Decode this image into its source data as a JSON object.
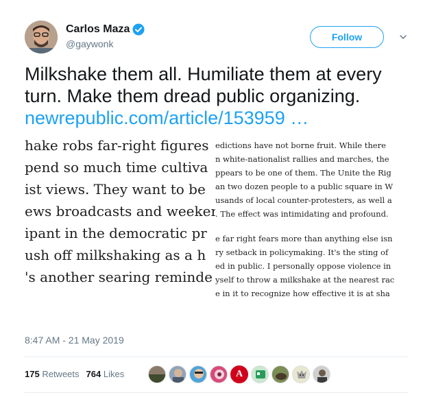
{
  "author": {
    "display_name": "Carlos Maza",
    "handle": "@gaywonk",
    "verified_icon": "verified-badge-icon"
  },
  "actions": {
    "follow_label": "Follow",
    "more_icon": "chevron-down-icon"
  },
  "tweet": {
    "text": "Milkshake them all. Humiliate them at every turn. Make them dread public organizing.",
    "link_text": "newrepublic.com/article/153959 …"
  },
  "media": {
    "left_lines": [
      "hake robs far-right figures",
      "pend so much time cultiva",
      "ist views. They want to be",
      "ews broadcasts and weeker",
      "ipant in the democratic pr",
      "ush off milkshaking as a h",
      "'s another searing reminde"
    ],
    "right_lines": [
      "edictions have not borne fruit. While there",
      "n white-nationalist rallies and marches, the",
      "ppears to be one of them. The Unite the Rig",
      "an two dozen people to a public square in W",
      "usands of local counter-protesters, as well a",
      ". The effect was intimidating and profound.",
      "e far right fears more than anything else isn",
      "ry setback in policymaking. It's the sting of",
      "ed in public. I personally oppose violence in",
      "yself to throw a milkshake at the nearest rac",
      "e in it to recognize how effective it is at sha"
    ]
  },
  "meta": {
    "timestamp": "8:47 AM - 21 May 2019"
  },
  "stats": {
    "retweets_count": "175",
    "retweets_label": "Retweets",
    "likes_count": "764",
    "likes_label": "Likes"
  },
  "likers": {
    "letter_avatar": "A"
  },
  "colors": {
    "accent": "#1da1f2",
    "text_primary": "#14171a",
    "text_secondary": "#657786",
    "divider": "#e6ecf0"
  }
}
